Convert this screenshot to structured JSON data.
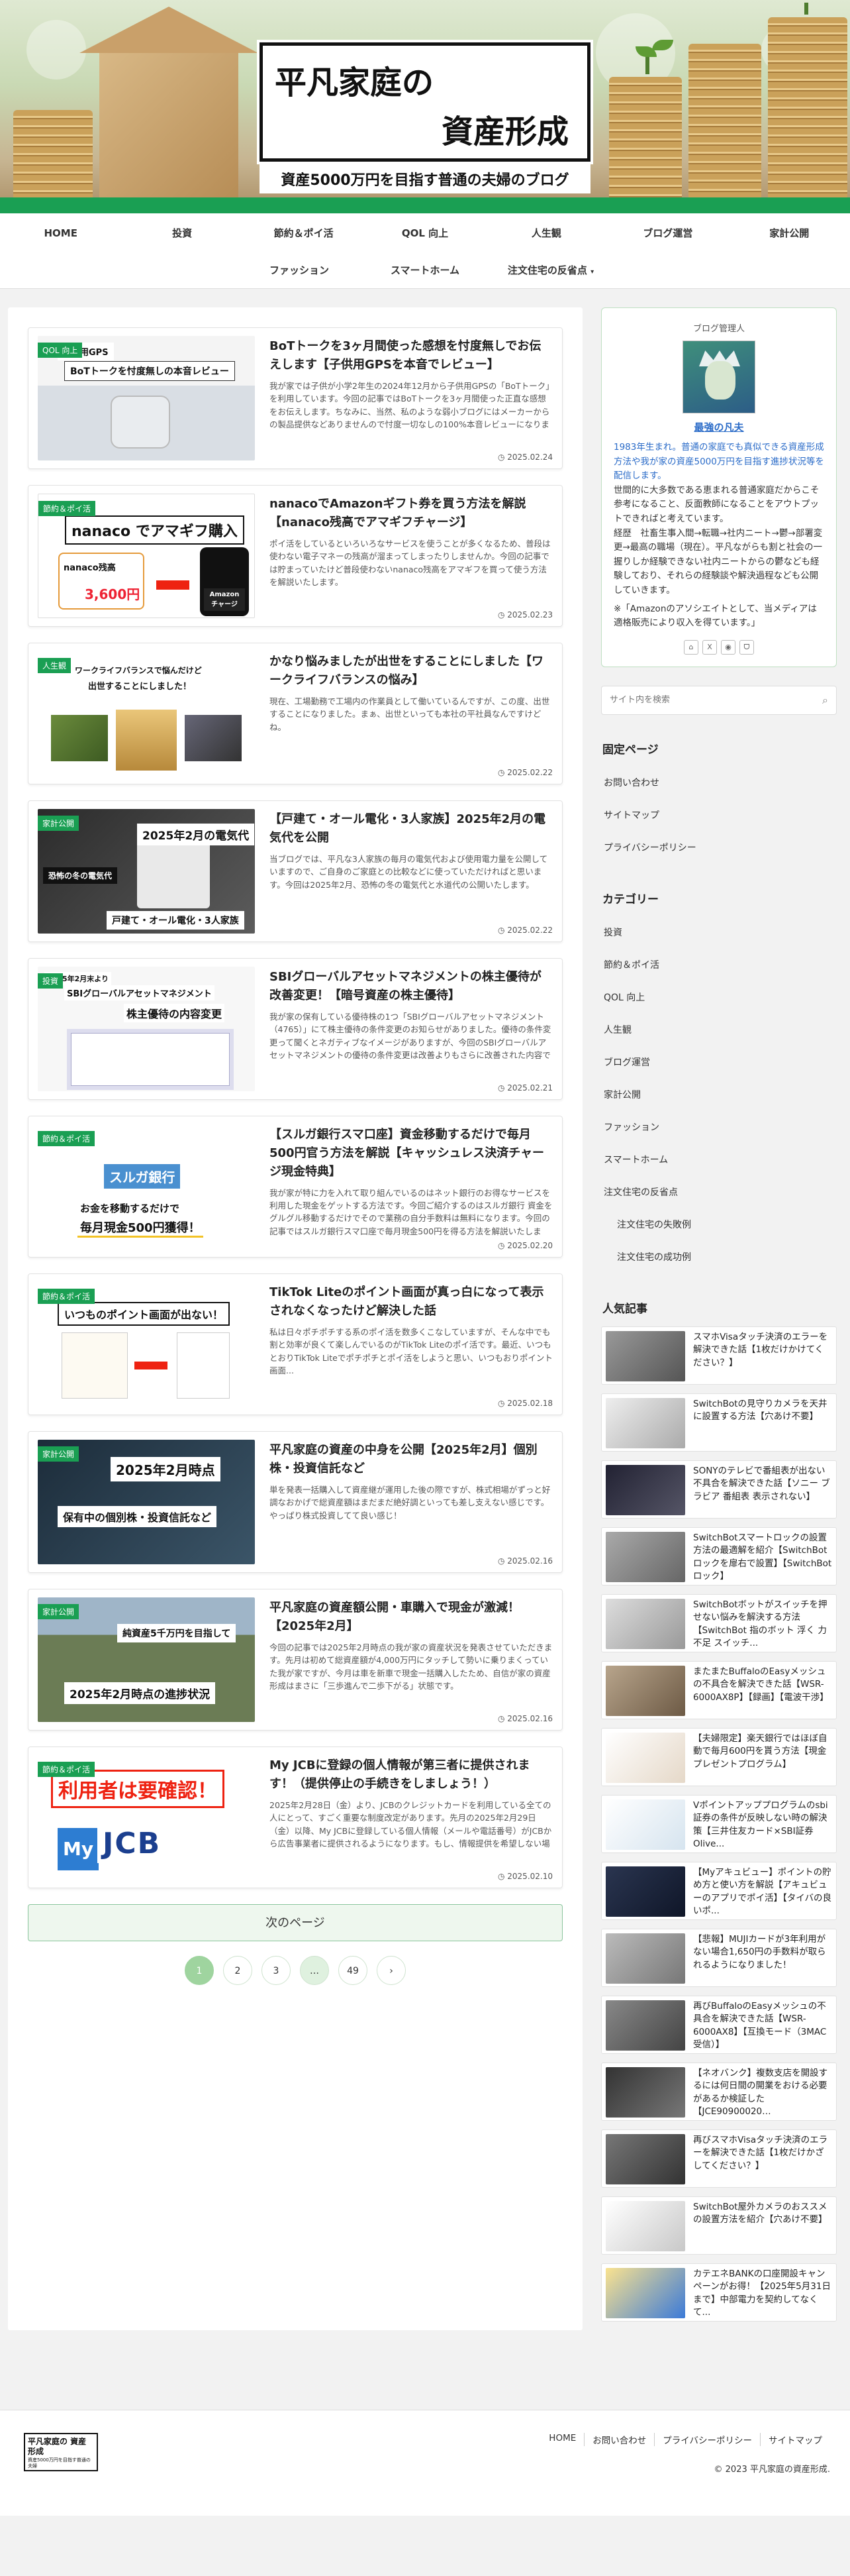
{
  "header": {
    "logo_line1": "平凡家庭の",
    "logo_line2": "資産形成",
    "tagline": "資産5000万円を目指す普通の夫婦のブログ"
  },
  "nav": {
    "row1": [
      "HOME",
      "投資",
      "節約＆ポイ活",
      "QOL 向上",
      "人生観",
      "ブログ運営",
      "家計公開"
    ],
    "row2": [
      "ファッション",
      "スマートホーム",
      "注文住宅の反省点"
    ],
    "dropdown_icon": "chevron-down-icon"
  },
  "posts": [
    {
      "cat": "QOL 向上",
      "thumb_text": [
        "子供用GPS",
        "BoTトークを忖度無しの本音レビュー"
      ],
      "title": "BoTトークを3ヶ月間使った感想を忖度無しでお伝えします【子供用GPSを本音でレビュー】",
      "snippet": "我が家では子供が小学2年生の2024年12月から子供用GPSの「BoTトーク」を利用しています。今回の記事ではBoTトークを3ヶ月間使った正直な感想をお伝えします。ちなみに、当然、私のような弱小ブログにはメーカーからの製品提供などありませんので忖度一切なしの100%本音レビューになります。",
      "date": "2025.02.24"
    },
    {
      "cat": "節約＆ポイ活",
      "thumb_text": [
        "nanaco でアマギフ購入",
        "nanaco残高",
        "3,600円",
        "Amazon チャージ"
      ],
      "title": "nanacoでAmazonギフト券を買う方法を解説【nanaco残高でアマギフチャージ】",
      "snippet": "ポイ活をしているといろいろなサービスを使うことが多くなるため、普段は使わない電子マネーの残高が溜まってしまったりしませんか。今回の記事では貯まっていたけど普段使わないnanaco残高をアマギフを買って使う方法を解説いたします。",
      "date": "2025.02.23"
    },
    {
      "cat": "人生観",
      "thumb_text": [
        "ワークライフバランスで悩んだけど",
        "出世することにしました！"
      ],
      "title": "かなり悩みましたが出世をすることにしました【ワークライフバランスの悩み】",
      "snippet": "現在、工場勤務で工場内の作業員として働いているんですが、この度、出世することになりました。まぁ、出世といっても本社の平社員なんですけどね。",
      "date": "2025.02.22"
    },
    {
      "cat": "家計公開",
      "thumb_text": [
        "2025年2月の電気代",
        "恐怖の冬の電気代",
        "戸建て・オール電化・3人家族"
      ],
      "title": "【戸建て・オール電化・3人家族】2025年2月の電気代を公開",
      "snippet": "当ブログでは、平凡な3人家族の毎月の電気代および使用電力量を公開していますので、ご自身のご家庭との比較などに使っていただければと思います。今回は2025年2月、恐怖の冬の電気代と水道代の公開いたします。",
      "date": "2025.02.22"
    },
    {
      "cat": "投資",
      "thumb_text": [
        "2025年2月末より",
        "SBIグローバルアセットマネジメント",
        "株主優待の内容変更"
      ],
      "title": "SBIグローバルアセットマネジメントの株主優待が改善変更！【暗号資産の株主優待】",
      "snippet": "我が家の保有している優待株の1つ「SBIグローバルアセットマネジメント（4765）」にて株主優待の条件変更のお知らせがありました。優待の条件変更って聞くとネガティブなイメージがありますが、今回のSBIグローバルアセットマネジメントの優待の条件変更は改善よりもさらに改善された内容でした。",
      "date": "2025.02.21"
    },
    {
      "cat": "節約＆ポイ活",
      "thumb_text": [
        "スルガ銀行",
        "お金を移動するだけで",
        "毎月現金500円獲得！"
      ],
      "title": "【スルガ銀行スマ口座】資金移動するだけで毎月500円官う方法を解説【キャッシュレス決済チャージ現金特典】",
      "snippet": "我が家が特に力を入れて取り組んでいるのはネット銀行のお得なサービスを利用した現金をゲットする方法です。今回ご紹介するのはスルガ銀行 資金をグルグル移動するだけでそので業務の自分手数料は無料になります。今回の記事ではスルガ銀行スマ口座で毎月現金500円を得る方法を解説いたします。",
      "date": "2025.02.20"
    },
    {
      "cat": "節約＆ポイ活",
      "thumb_text": [
        "いつものポイント画面が出ない！"
      ],
      "title": "TikTok Liteのポイント画面が真っ白になって表示されなくなったけど解決した話",
      "snippet": "私は日々ポチポチする系のポイ活を数多くこなしていますが、そんな中でも割と効率が良くて楽しんでいるのがTikTok Liteのポイ活です。最近、いつもとおりTikTok Liteでポチポチとポイ活をしようと思い、いつもおりポイント画面...",
      "date": "2025.02.18"
    },
    {
      "cat": "家計公開",
      "thumb_text": [
        "2025年2月時点",
        "保有中の個別株・投資信託など"
      ],
      "title": "平凡家庭の資産の中身を公開【2025年2月】個別株・投資信託など",
      "snippet": "単を発表一括購入して資産継が運用した後の際ですが、株式相場がずっと好調なおかげで総資産額はまだまだ絶好調といっても差し支えない感じです。やっぱり株式投資してて良い感じ！",
      "date": "2025.02.16"
    },
    {
      "cat": "家計公開",
      "thumb_text": [
        "純資産5千万円を目指して",
        "2025年2月時点の進捗状況"
      ],
      "title": "平凡家庭の資産額公開・車購入で現金が激減！【2025年2月】",
      "snippet": "今回の記事では2025年2月時点の我が家の資産状況を発表させていただきます。先月は初めて総資産額が4,000万円にタッチして勢いに乗りまくっていた我が家ですが、今月は車を新車で現金一括購入したため、自信が家の資産形成はまさに「三歩進んで二歩下がる」状態です。",
      "date": "2025.02.16"
    },
    {
      "cat": "節約＆ポイ活",
      "thumb_text": [
        "利用者は要確認！",
        "My",
        "JCB"
      ],
      "title": "My JCBに登録の個人情報が第三者に提供されます！（提供停止の手続きをしましょう！）",
      "snippet": "2025年2月28日（金）より、JCBのクレジットカードを利用している全ての人にとって、すごく重要な制度改定があります。先月の2025年2月29日（金）以降、My JCBに登録している個人情報（メールや電話番号）がJCBから広告事業者に提供されるようになります。もし、情報提供を希望しない場合は自分...",
      "date": "2025.02.10"
    }
  ],
  "pagination": {
    "next_label": "次のページ",
    "pages": [
      "1",
      "2",
      "3",
      "…",
      "49",
      "›"
    ]
  },
  "profile": {
    "title": "ブログ管理人",
    "name": "最強の凡夫",
    "bio_lines": [
      "1983年生まれ。普通の家庭でも真似できる資産形成方法や我が家の資産5000万円を目指す進捗状況等を配信します。",
      "世間的に大多数である恵まれる普通家庭だからこそ参考になること、反面教師になることをアウトプットできればと考えています。",
      "経歴　社畜生事入間→転職→社内ニート→鬱→部署変更→最高の職場（現在）。平凡ながらも割と社会の一握りしか経験できない社内ニートからの鬱なども経験しており、それらの経験談や解決過程なども公開していきます。"
    ],
    "affiliate_note": "※「Amazonのアソシエイトとして、当メディアは適格販売により収入を得ています。」",
    "social": [
      "home",
      "x",
      "rss",
      "feedly"
    ]
  },
  "search": {
    "placeholder": "サイト内を検索"
  },
  "fixed_pages": {
    "title": "固定ページ",
    "items": [
      "お問い合わせ",
      "サイトマップ",
      "プライバシーポリシー"
    ]
  },
  "categories": {
    "title": "カテゴリー",
    "items": [
      "投資",
      "節約＆ポイ活",
      "QOL 向上",
      "人生観",
      "ブログ運営",
      "家計公開",
      "ファッション",
      "スマートホーム",
      "注文住宅の反省点"
    ],
    "sub_items": [
      "注文住宅の失敗例",
      "注文住宅の成功例"
    ]
  },
  "popular": {
    "title": "人気記事",
    "items": [
      "スマホVisaタッチ決済のエラーを解決できた話【1枚だけかけてください？】",
      "SwitchBotの見守りカメラを天井に設置する方法【穴あけ不要】",
      "SONYのテレビで番組表が出ない不具合を解決できた話【ソニー ブラビア 番組表 表示されない】",
      "SwitchBotスマートロックの設置方法の最適解を紹介【SwitchBotロックを扉右で設置】【SwitchBotロック】",
      "SwitchBotボットがスイッチを押せない悩みを解決する方法【SwitchBot 指のボット 浮く 力不足 スイッチ...",
      "またまたBuffaloのEasyメッシュの不具合を解決できた話【WSR-6000AX8P】【録画】【電波干渉】",
      "【夫婦限定】楽天銀行ではほぼ自動で毎月600円を貰う方法【現金プレゼントプログラム】",
      "Vポイントアッププログラムのsbi証券の条件が反映しない時の解決策【三井住友カード×SBI証券 Olive...",
      "【Myアキュビュー】ポイントの貯め方と使い方を解説【アキュビューのアプリでポイ活】【タイバの良いポ...",
      "【悲報】MUJIカードが3年利用がない場合1,650円の手数料が取られるようになりました！",
      "再びBuffaloのEasyメッシュの不具合を解決できた話【WSR-6000AX8】【互換モード（3MAC受信）】",
      "【ネオバンク】複数支店を開設するには何日間の開業をおける必要があるか検証した【JCE90900020…",
      "再びスマホVisaタッチ決済のエラーを解決できた話【1枚だけかざしてください？】",
      "SwitchBot屋外カメラのおススメの設置方法を紹介【穴あけ不要】",
      "カテエネBANKの口座開設キャンペーンがお得！【2025年5月31日まで】中部電力を契約してなくて..."
    ]
  },
  "footer": {
    "logo_text": "平凡家庭の 資産形成",
    "logo_sub": "資産5000万円を目指す普通の夫婦",
    "links": [
      "HOME",
      "お問い合わせ",
      "プライバシーポリシー",
      "サイトマップ"
    ],
    "copyright": "© 2023 平凡家庭の資産形成."
  },
  "colors": {
    "accent": "#1a9f53",
    "link": "#2a6bc8"
  }
}
